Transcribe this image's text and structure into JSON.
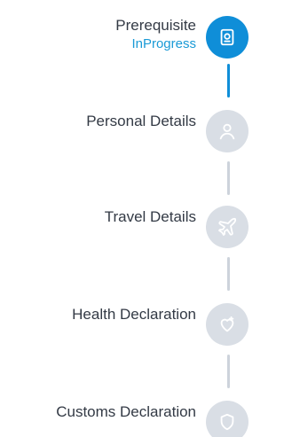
{
  "steps": [
    {
      "label": "Prerequisite",
      "status": "InProgress",
      "icon": "passport-icon",
      "state": "active"
    },
    {
      "label": "Personal Details",
      "icon": "user-icon",
      "state": "inactive"
    },
    {
      "label": "Travel Details",
      "icon": "airplane-icon",
      "state": "inactive"
    },
    {
      "label": "Health Declaration",
      "icon": "heart-plus-icon",
      "state": "inactive"
    },
    {
      "label": "Customs Declaration",
      "icon": "shield-icon",
      "state": "inactive"
    }
  ],
  "colors": {
    "active": "#0f8ed8",
    "status_text": "#1a9ad6",
    "inactive_circle": "#d9dee5",
    "inactive_line": "#cdd3db",
    "label_text": "#333a45"
  }
}
